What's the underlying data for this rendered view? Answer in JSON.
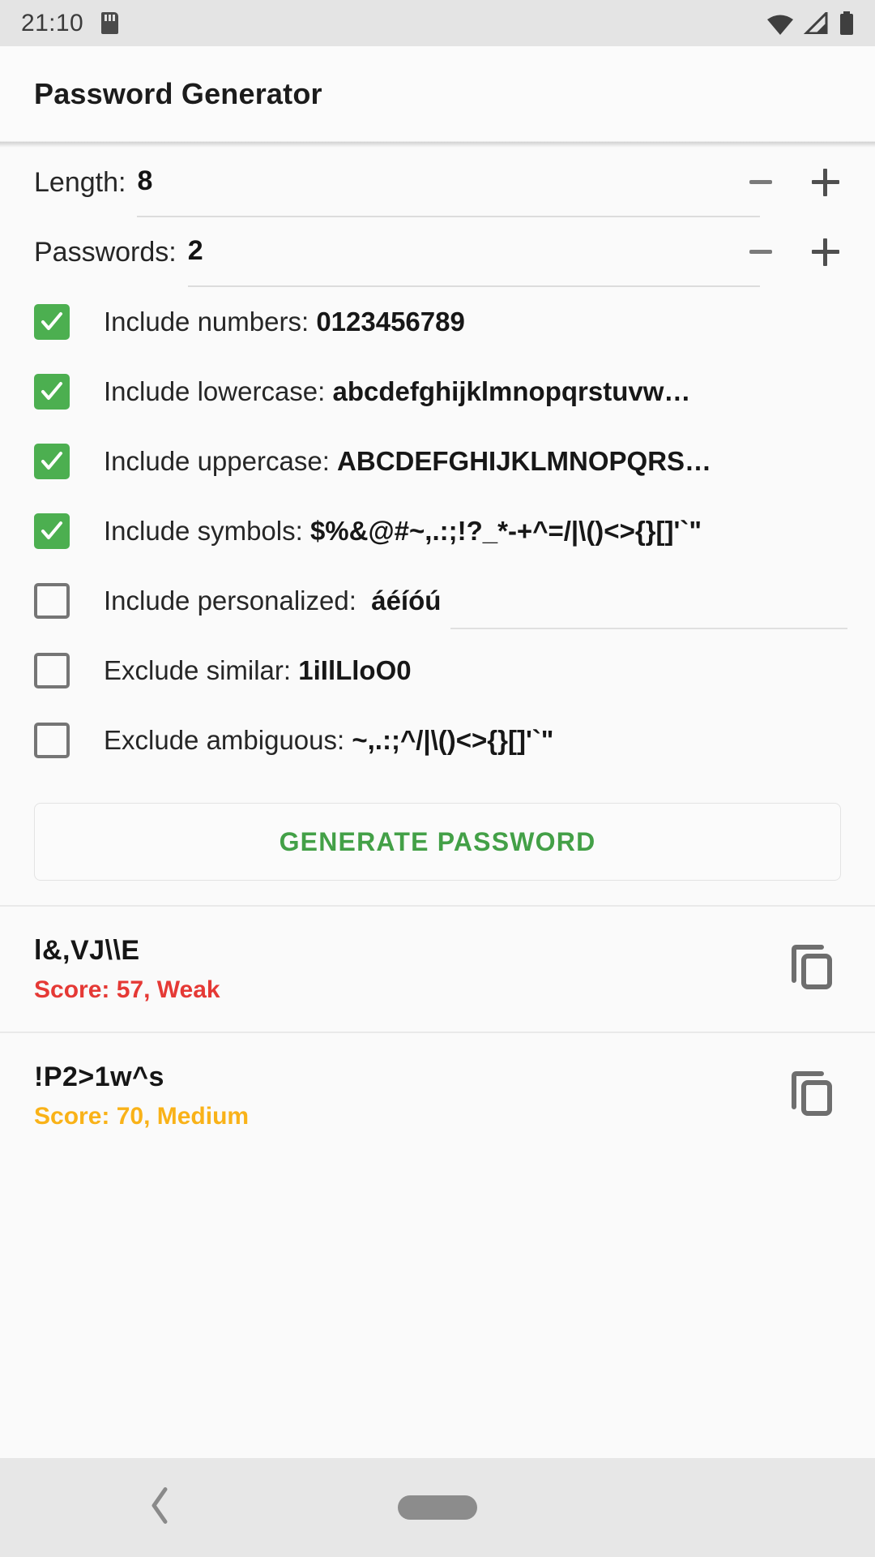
{
  "status_bar": {
    "time": "21:10",
    "icons": [
      "sd-card-icon",
      "wifi-icon",
      "cellular-signal-icon",
      "battery-icon"
    ]
  },
  "app_bar": {
    "title": "Password Generator"
  },
  "settings": {
    "length": {
      "label": "Length:",
      "value": "8",
      "decrement": "−",
      "increment": "+"
    },
    "passwords": {
      "label": "Passwords:",
      "value": "2",
      "decrement": "−",
      "increment": "+"
    }
  },
  "options": [
    {
      "label": "Include numbers:",
      "value": "0123456789",
      "checked": true
    },
    {
      "label": "Include lowercase:",
      "value": "abcdefghijklmnopqrstuvw…",
      "checked": true
    },
    {
      "label": "Include uppercase:",
      "value": "ABCDEFGHIJKLMNOPQRS…",
      "checked": true
    },
    {
      "label": "Include symbols:",
      "value": "$%&@#~,.:;!?_*-+^=/|\\()<>{}[]'`\"",
      "checked": true
    },
    {
      "label": "Include personalized:",
      "value": "áéíóú",
      "checked": false
    },
    {
      "label": "Exclude similar:",
      "value": "1iIlLloO0",
      "checked": false
    },
    {
      "label": "Exclude ambiguous:",
      "value": "~,.:;^/|\\()<>{}[]'`\"",
      "checked": false
    }
  ],
  "generate_button": {
    "label": "GENERATE PASSWORD"
  },
  "results": [
    {
      "password": "l&,VJ\\\\E",
      "score_text": "Score: 57, Weak",
      "score_color": "#e53935",
      "copy_icon": "copy-icon"
    },
    {
      "password": "!P2>1w^s",
      "score_text": "Score: 70, Medium",
      "score_color": "#f9b218",
      "copy_icon": "copy-icon"
    }
  ],
  "nav_bar": {
    "back": "back-icon",
    "home": "home-pill"
  },
  "colors": {
    "accent_green": "#4caf50",
    "button_green": "#43a047",
    "weak_red": "#e53935",
    "medium_amber": "#f9b218",
    "page_bg": "#fafafa",
    "status_bg": "#e4e4e4",
    "nav_bg": "#e7e7e7"
  }
}
